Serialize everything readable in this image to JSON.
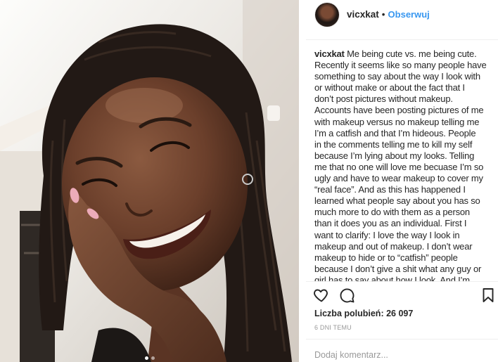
{
  "photo": {
    "carousel_dots": 2,
    "active_dot": 1
  },
  "header": {
    "username": "vicxkat",
    "separator": "•",
    "follow_label": "Obserwuj"
  },
  "caption": {
    "username": "vicxkat",
    "lines": [
      "Me being cute vs. me being cute.",
      "Recently it seems like so many people have",
      "something to say about the way I look with",
      "or without make or about the fact that I",
      "don’t post pictures without makeup.",
      "Accounts have been posting pictures of me",
      "with makeup versus no makeup telling me",
      "I’m a catfish and that I’m hideous. People",
      "in the comments telling me to kill my self",
      "because I’m lying about my looks. Telling",
      "me that no one will love me becuase I’m so",
      "ugly and have to wear makeup to cover my",
      "“real face”. And as this has happened I",
      "learned what people say about you has so",
      "much more to do with them as a person",
      "than it does you as an individual. First I",
      "want to clarify: I love the way I look in",
      "makeup and out of makeup. I don’t wear",
      "makeup to hide or to “catfish” people",
      "because I don’t give a shit what any guy or",
      "girl has to say about how I look. And I’m"
    ]
  },
  "actions": {
    "like": "heart-icon",
    "comment": "comment-icon",
    "save": "bookmark-icon"
  },
  "likes": {
    "label": "Liczba polubień:",
    "count": "26 097"
  },
  "timestamp": "6 DNI TEMU",
  "comment_box": {
    "placeholder": "Dodaj komentarz..."
  },
  "colors": {
    "text": "#262626",
    "link": "#3897f0",
    "muted": "#999999",
    "border": "#efefef"
  }
}
